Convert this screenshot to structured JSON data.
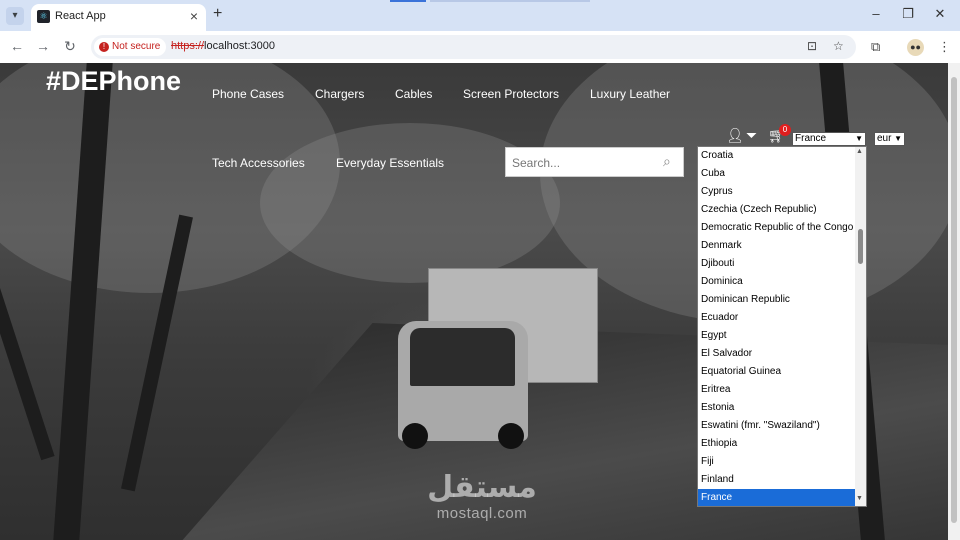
{
  "browser": {
    "tab_title": "React App",
    "url_scheme": "https://",
    "url_rest": "localhost:3000",
    "security_label": "Not secure"
  },
  "site": {
    "logo": "#DEPhone",
    "nav": [
      "Phone Cases",
      "Chargers",
      "Cables",
      "Screen Protectors",
      "Luxury Leather",
      "Tech Accessories",
      "Everyday Essentials"
    ],
    "search_placeholder": "Search...",
    "cart_count": "0",
    "country_selected": "France",
    "currency_selected": "eur",
    "watermark_arabic": "مستقل",
    "watermark_latin": "mostaql.com"
  },
  "country_options": [
    "Croatia",
    "Cuba",
    "Cyprus",
    "Czechia (Czech Republic)",
    "Democratic Republic of the Congo",
    "Denmark",
    "Djibouti",
    "Dominica",
    "Dominican Republic",
    "Ecuador",
    "Egypt",
    "El Salvador",
    "Equatorial Guinea",
    "Eritrea",
    "Estonia",
    "Eswatini (fmr. \"Swaziland\")",
    "Ethiopia",
    "Fiji",
    "Finland",
    "France"
  ],
  "colors": {
    "accent_selected": "#1a6cd8",
    "badge": "#e01e1e",
    "not_secure": "#c5221f"
  }
}
